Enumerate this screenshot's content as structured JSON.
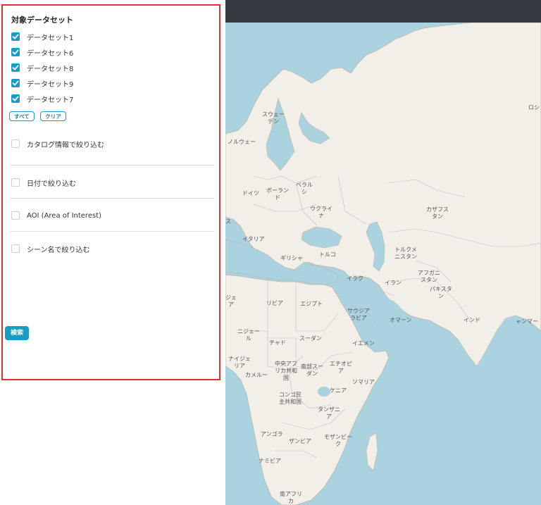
{
  "panel": {
    "title": "対象データセット",
    "datasets": [
      {
        "label": "データセット1",
        "checked": true
      },
      {
        "label": "データセット6",
        "checked": true
      },
      {
        "label": "データセット8",
        "checked": true
      },
      {
        "label": "データセット9",
        "checked": true
      },
      {
        "label": "データセット7",
        "checked": true
      }
    ],
    "select_all_label": "すべて",
    "clear_label": "クリア",
    "filters": [
      {
        "label": "カタログ情報で絞り込む",
        "checked": false
      },
      {
        "label": "日付で絞り込む",
        "checked": false
      },
      {
        "label": "AOI (Area of Interest)",
        "checked": false
      },
      {
        "label": "シーン名で絞り込む",
        "checked": false
      }
    ],
    "search_label": "検索"
  },
  "map": {
    "labels": [
      "スウェー\nデン",
      "ノルウェー",
      "ロシ",
      "ドイツ",
      "ポーラン\nド",
      "ベラル\nシ",
      "ウクライ\nナ",
      "カザフス\nタン",
      "ス",
      "イタリア",
      "ギリシャ",
      "トルコ",
      "トルクメ\nニスタン",
      "アフガニ\nスタン",
      "パキスタ\nン",
      "イラク",
      "イラン",
      "ジェ\nア",
      "リビア",
      "エジプト",
      "サウジア\nラビア",
      "オマーン",
      "インド",
      "ャンマー",
      "ニジェー\nル",
      "チャド",
      "スーダン",
      "イエメン",
      "ナイジェ\nリア",
      "中央アフ\nリカ共和\n国",
      "南部スー\nダン",
      "エチオピ\nア",
      "カメルー",
      "ソマリア",
      "ケニア",
      "コンゴ民\n主共和国",
      "タンザニ\nア",
      "アンゴラ",
      "ザンビア",
      "モザンビー\nク",
      "ナミビア",
      "南アフリ\nカ"
    ]
  }
}
